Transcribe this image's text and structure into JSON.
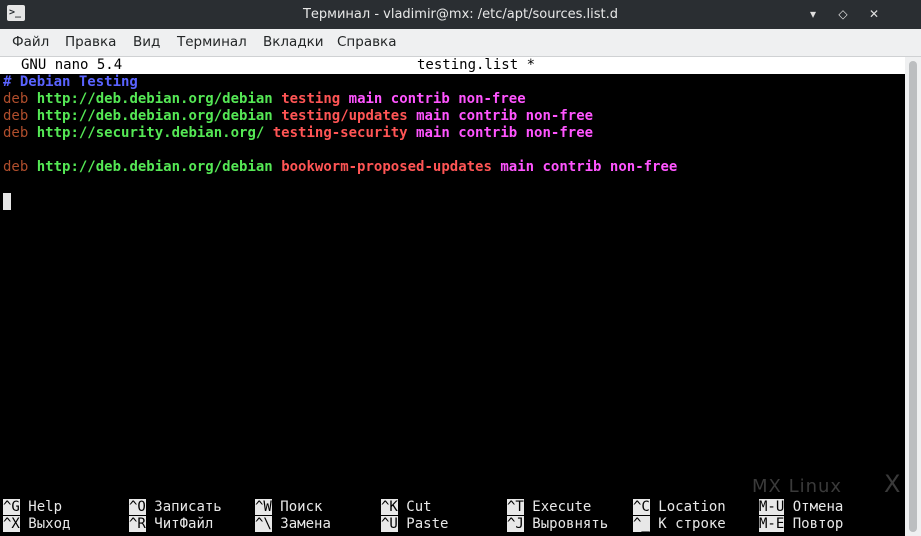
{
  "window": {
    "title": "Терминал - vladimir@mx: /etc/apt/sources.list.d",
    "app_icon": ">_",
    "buttons": {
      "minimize": "▾",
      "maximize": "◇",
      "close": "✕"
    }
  },
  "menu": [
    "Файл",
    "Правка",
    "Вид",
    "Терминал",
    "Вкладки",
    "Справка"
  ],
  "nano": {
    "version": "GNU nano 5.4",
    "filename": "testing.list *"
  },
  "file": {
    "comment": "# Debian Testing",
    "lines": [
      {
        "deb": "deb",
        "url": "http://deb.debian.org/debian",
        "suite": "testing",
        "components": "main contrib non-free"
      },
      {
        "deb": "deb",
        "url": "http://deb.debian.org/debian",
        "suite": "testing/updates",
        "components": "main contrib non-free"
      },
      {
        "deb": "deb",
        "url": "http://security.debian.org/",
        "suite": "testing-security",
        "components": "main contrib non-free"
      },
      {
        "deb": "deb",
        "url": "http://deb.debian.org/debian",
        "suite": "bookworm-proposed-updates",
        "components": "main contrib non-free"
      }
    ]
  },
  "shortcuts": [
    {
      "key": "^G",
      "label": "Help"
    },
    {
      "key": "^X",
      "label": "Выход"
    },
    {
      "key": "^O",
      "label": "Записать"
    },
    {
      "key": "^R",
      "label": "ЧитФайл"
    },
    {
      "key": "^W",
      "label": "Поиск"
    },
    {
      "key": "^\\",
      "label": "Замена"
    },
    {
      "key": "^K",
      "label": "Cut"
    },
    {
      "key": "^U",
      "label": "Paste"
    },
    {
      "key": "^T",
      "label": "Execute"
    },
    {
      "key": "^J",
      "label": "Выровнять"
    },
    {
      "key": "^C",
      "label": "Location"
    },
    {
      "key": "^_",
      "label": "К строке"
    },
    {
      "key": "M-U",
      "label": "Отмена"
    },
    {
      "key": "M-E",
      "label": "Повтор"
    }
  ],
  "watermark": "MX Linux",
  "colors": {
    "comment": "#5a63ff",
    "deb": "#b04e2c",
    "url": "#55e855",
    "suite": "#ff5555",
    "components": "#ff55ff"
  }
}
